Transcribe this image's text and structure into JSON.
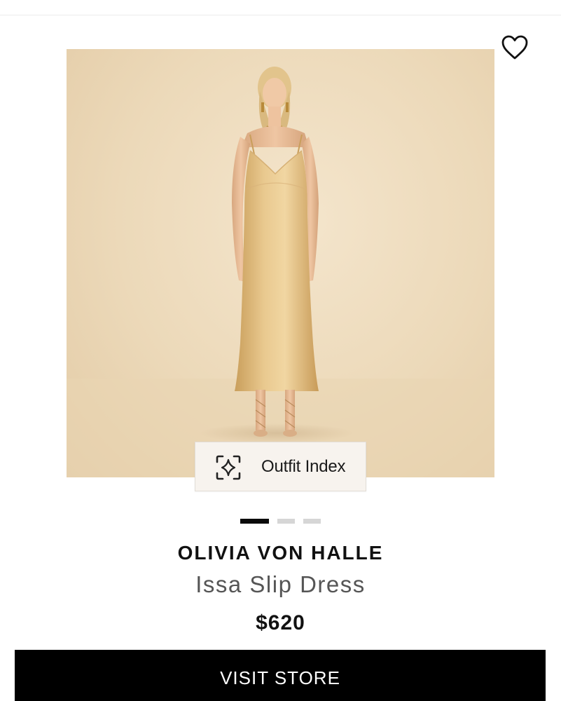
{
  "product": {
    "brand": "OLIVIA VON HALLE",
    "name": "Issa Slip Dress",
    "price": "$620"
  },
  "image": {
    "dots": [
      {
        "active": true
      },
      {
        "active": false
      },
      {
        "active": false
      }
    ]
  },
  "outfit_index": {
    "label": "Outfit Index",
    "icon": "sparkle-scan-icon"
  },
  "wishlist": {
    "icon": "heart-icon"
  },
  "cta": {
    "label": "VISIT STORE",
    "background": "#000000",
    "color": "#ffffff"
  }
}
